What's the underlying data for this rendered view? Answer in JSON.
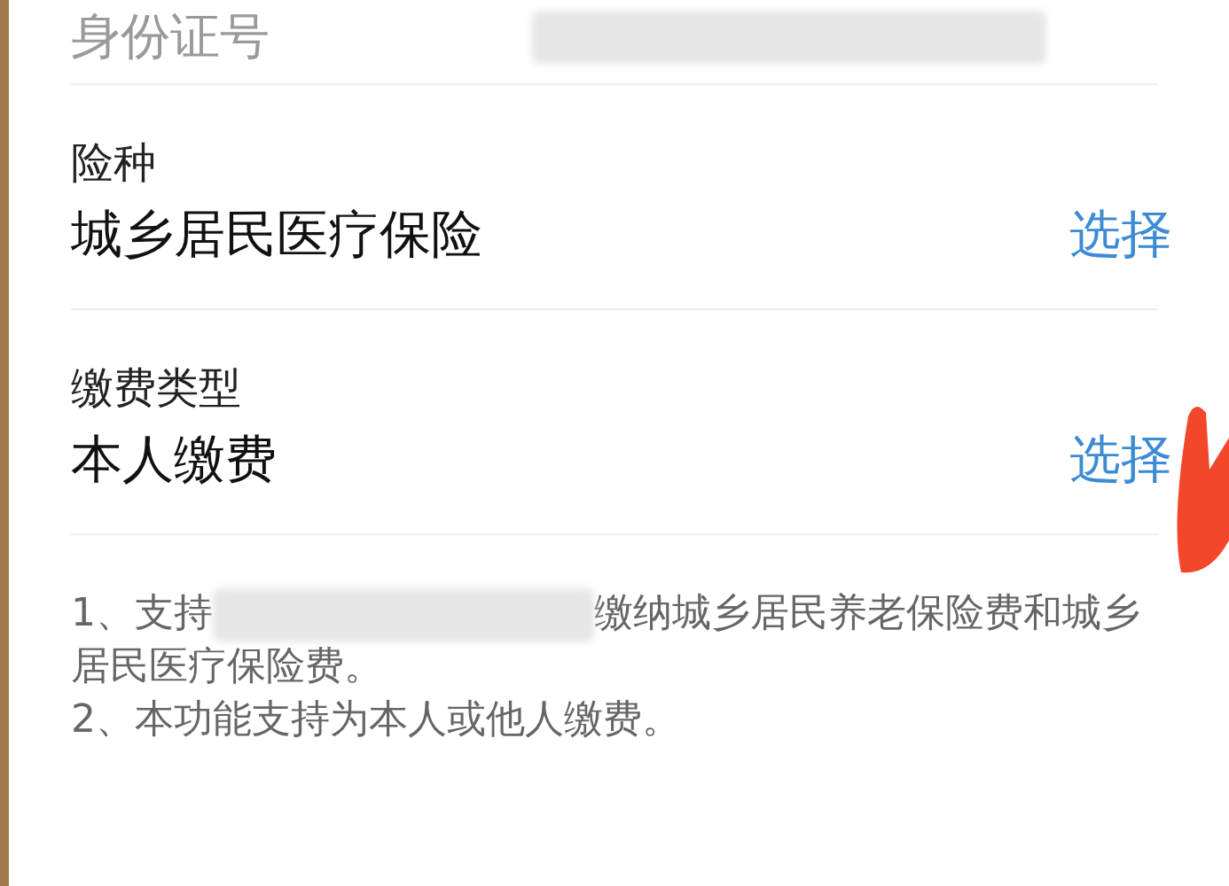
{
  "fields": [
    {
      "kind": "masked",
      "label": "身份证号"
    },
    {
      "kind": "select",
      "label": "险种",
      "value": "城乡居民医疗保险",
      "action": "选择"
    },
    {
      "kind": "select",
      "label": "缴费类型",
      "value": "本人缴费",
      "action": "选择"
    }
  ],
  "notes": [
    {
      "kind": "masked",
      "before": "1、支持",
      "after": "缴纳城乡居民养老保险费和城乡居民医疗保险费。"
    },
    {
      "kind": "plain",
      "text": "2、本功能支持为本人或他人缴费。"
    }
  ]
}
